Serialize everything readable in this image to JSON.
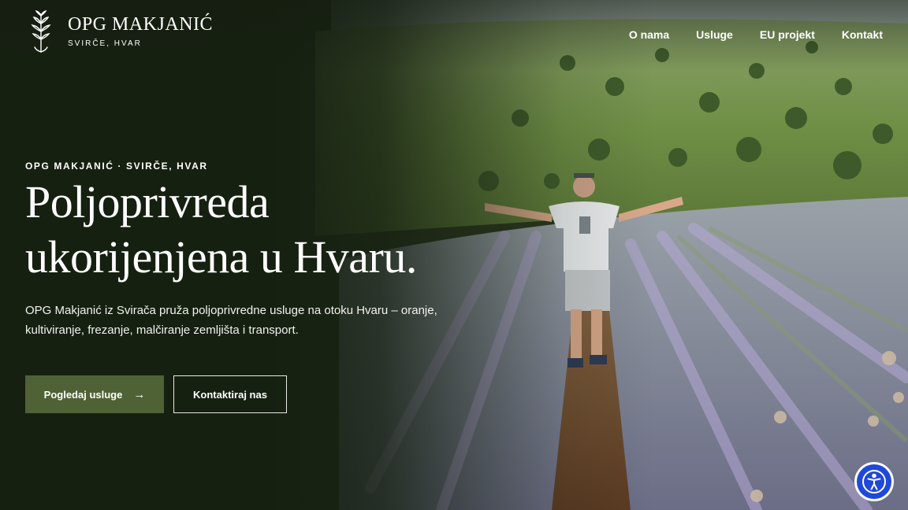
{
  "brand": {
    "name": "OPG MAKJANIĆ",
    "location": "SVIRČE, HVAR",
    "logo_icon": "lavender-sprig-icon"
  },
  "nav": {
    "items": [
      {
        "label": "O nama"
      },
      {
        "label": "Usluge"
      },
      {
        "label": "EU projekt"
      },
      {
        "label": "Kontakt"
      }
    ]
  },
  "hero": {
    "eyebrow": "OPG MAKJANIĆ · SVIRČE, HVAR",
    "headline_line1": "Poljoprivreda",
    "headline_line2": "ukorijenjena u Hvaru.",
    "lead": "OPG Makjanić iz Svirača pruža poljoprivredne usluge na otoku Hvaru – oranje, kultiviranje, frezanje, malčiranje zemljišta i transport.",
    "primary_button": "Pogledaj usluge",
    "primary_button_icon": "arrow-right-icon",
    "secondary_button": "Kontaktiraj nas"
  },
  "accessibility_widget": {
    "icon": "accessibility-icon"
  },
  "colors": {
    "primary_button_bg": "#4e6236",
    "overlay_dark": "#162011",
    "a11y_blue": "#1f49d8"
  }
}
